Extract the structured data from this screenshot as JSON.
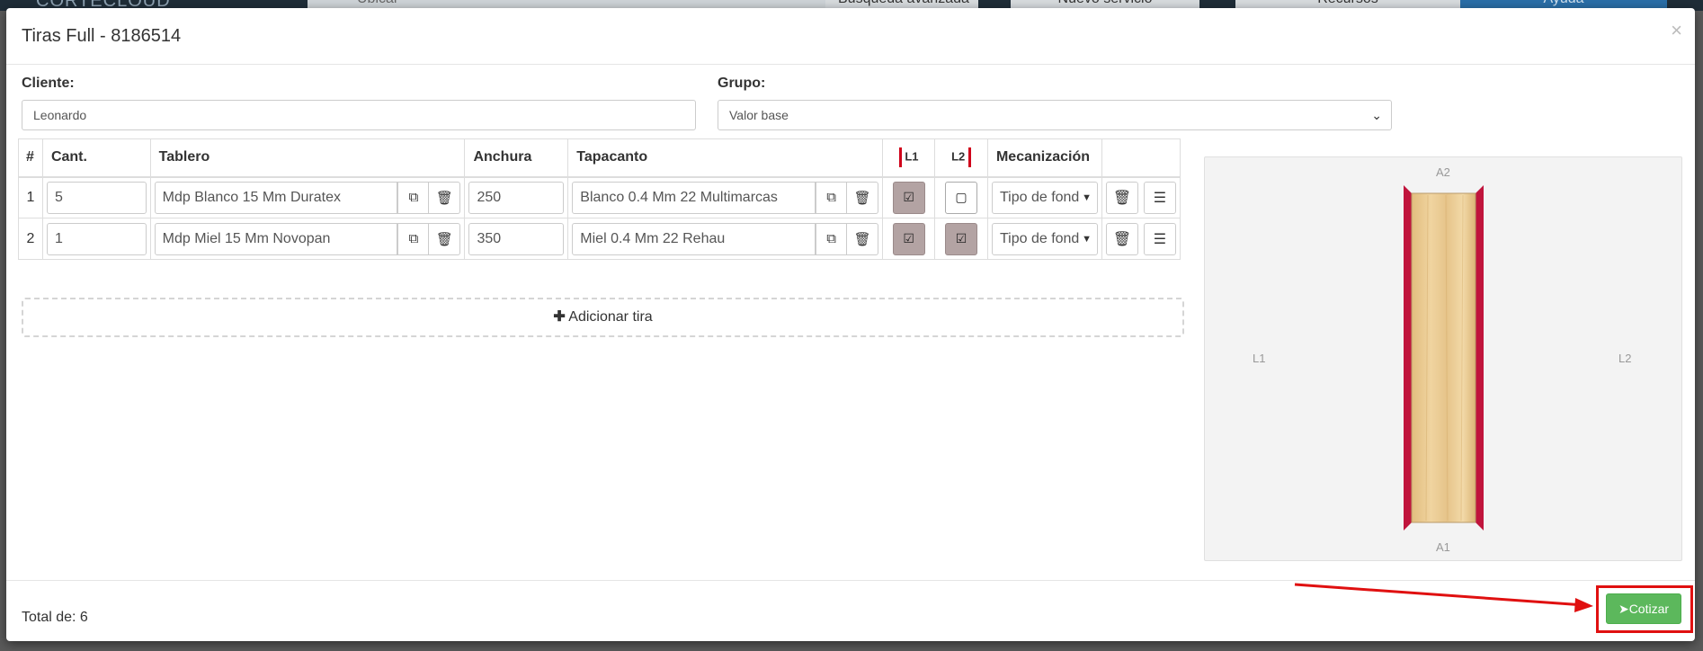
{
  "background_nav": {
    "brand": "CORTECLOUD",
    "search_placeholder": "Ubicar",
    "advanced_search": "Búsqueda avanzada",
    "new_service": "Nuevo servicio",
    "resources": "Recursos",
    "help": "Ayuda"
  },
  "modal": {
    "title": "Tiras Full - 8186514",
    "close": "×"
  },
  "form": {
    "client_label": "Cliente:",
    "client_value": "Leonardo",
    "group_label": "Grupo:",
    "group_value": "Valor base"
  },
  "table": {
    "headers": {
      "num": "#",
      "qty": "Cant.",
      "board": "Tablero",
      "width": "Anchura",
      "edge": "Tapacanto",
      "l1": "L1",
      "l2": "L2",
      "machining": "Mecanización"
    },
    "rows": [
      {
        "index": "1",
        "qty": "5",
        "board": "Mdp Blanco 15 Mm Duratex",
        "width": "250",
        "edge": "Blanco 0.4 Mm 22 Multimarcas",
        "l1_checked": true,
        "l2_checked": false,
        "machining": "Tipo de fondo"
      },
      {
        "index": "2",
        "qty": "1",
        "board": "Mdp Miel 15 Mm Novopan",
        "width": "350",
        "edge": "Miel 0.4 Mm 22 Rehau",
        "l1_checked": true,
        "l2_checked": true,
        "machining": "Tipo de fondo"
      }
    ]
  },
  "add_strip": "Adicionar tira",
  "preview": {
    "top_label": "A2",
    "bottom_label": "A1",
    "left_label": "L1",
    "right_label": "L2",
    "edge_color": "#c0143c",
    "wood_color": "#e8c98f"
  },
  "footer": {
    "total": "Total de: 6",
    "quote_button": "Cotizar"
  },
  "colors": {
    "accent_green": "#5cb85c",
    "annotation_red": "#e01010",
    "checked_bg": "#b3a3a3"
  }
}
